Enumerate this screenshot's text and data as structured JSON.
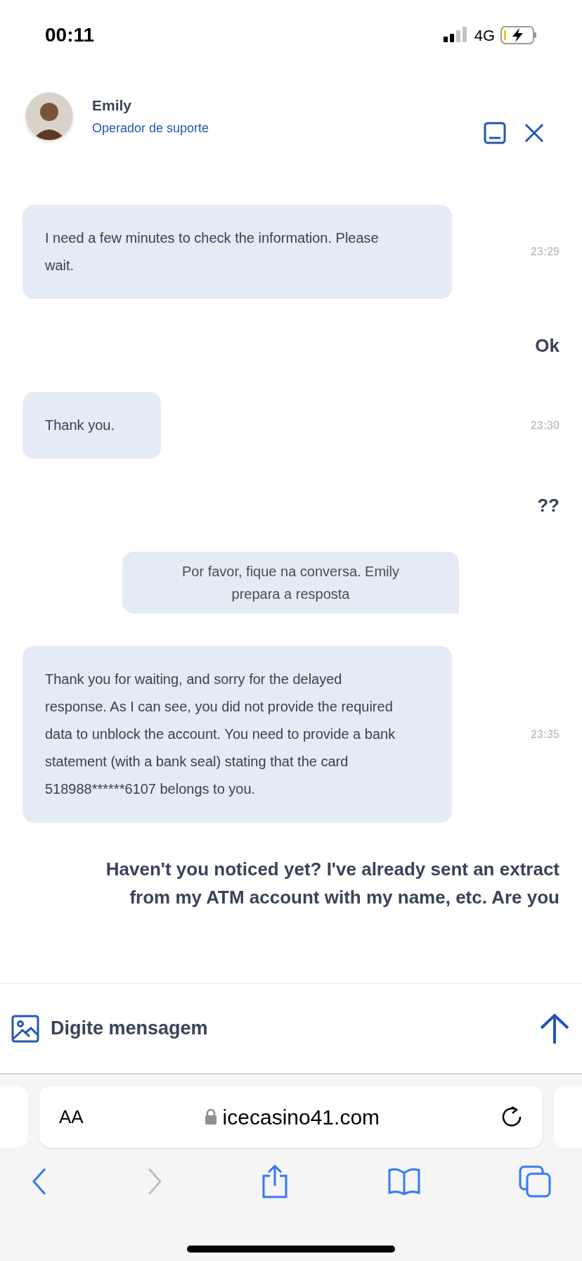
{
  "status_bar": {
    "time": "00:11",
    "network": "4G"
  },
  "header": {
    "name": "Emily",
    "role": "Operador de suporte"
  },
  "messages": [
    {
      "kind": "agent",
      "text": "I need a few minutes to check the information. Please wait.",
      "time": "23:29"
    },
    {
      "kind": "user",
      "lines": [
        "Ok"
      ]
    },
    {
      "kind": "agent",
      "text": "Thank you.",
      "time": "23:30"
    },
    {
      "kind": "user",
      "lines": [
        "??"
      ]
    },
    {
      "kind": "system",
      "text": "Por favor, fique na conversa. Emily prepara a resposta"
    },
    {
      "kind": "agent",
      "text": "Thank you for waiting, and sorry for the delayed response. As I can see, you did not provide the required data to unblock the account. You need to provide a bank statement (with a bank seal) stating that the card 518988******6107 belongs to you.",
      "time": "23:35"
    },
    {
      "kind": "user",
      "lines": [
        "Haven't you noticed yet? I've already sent an extract",
        "from my ATM account with my name, etc. Are you"
      ]
    }
  ],
  "composer": {
    "placeholder": "Digite mensagem"
  },
  "browser": {
    "text_size": "AA",
    "url": "icecasino41.com"
  }
}
